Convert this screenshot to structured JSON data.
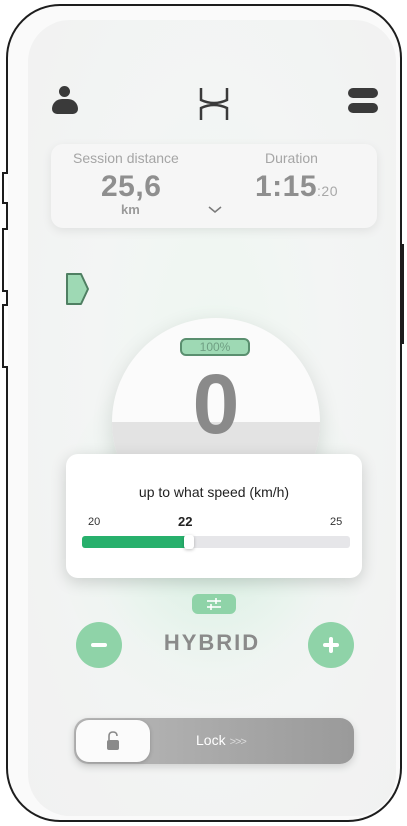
{
  "session": {
    "distance_label": "Session distance",
    "distance_value": "25,6",
    "distance_unit": "km",
    "duration_label": "Duration",
    "duration_value": "1:15",
    "duration_seconds": ":20"
  },
  "gauge": {
    "battery": "100%",
    "speed": "0"
  },
  "speed_limit": {
    "title": "up to what speed (km/h)",
    "min": "20",
    "value": "22",
    "max": "25",
    "fill_fraction": 0.4
  },
  "mode": {
    "label": "HYBRID"
  },
  "lock": {
    "label": "Lock",
    "arrows": ">>>"
  },
  "icons": [
    "user-icon",
    "brand-logo-icon",
    "menu-icon",
    "chevron-down-icon",
    "tag-icon",
    "settings-sliders-icon",
    "minus-icon",
    "plus-icon",
    "padlock-icon"
  ],
  "colors": {
    "accent": "#8fd3a8",
    "slider_fill": "#27b06c",
    "battery_fill": "#9ed9b4"
  }
}
